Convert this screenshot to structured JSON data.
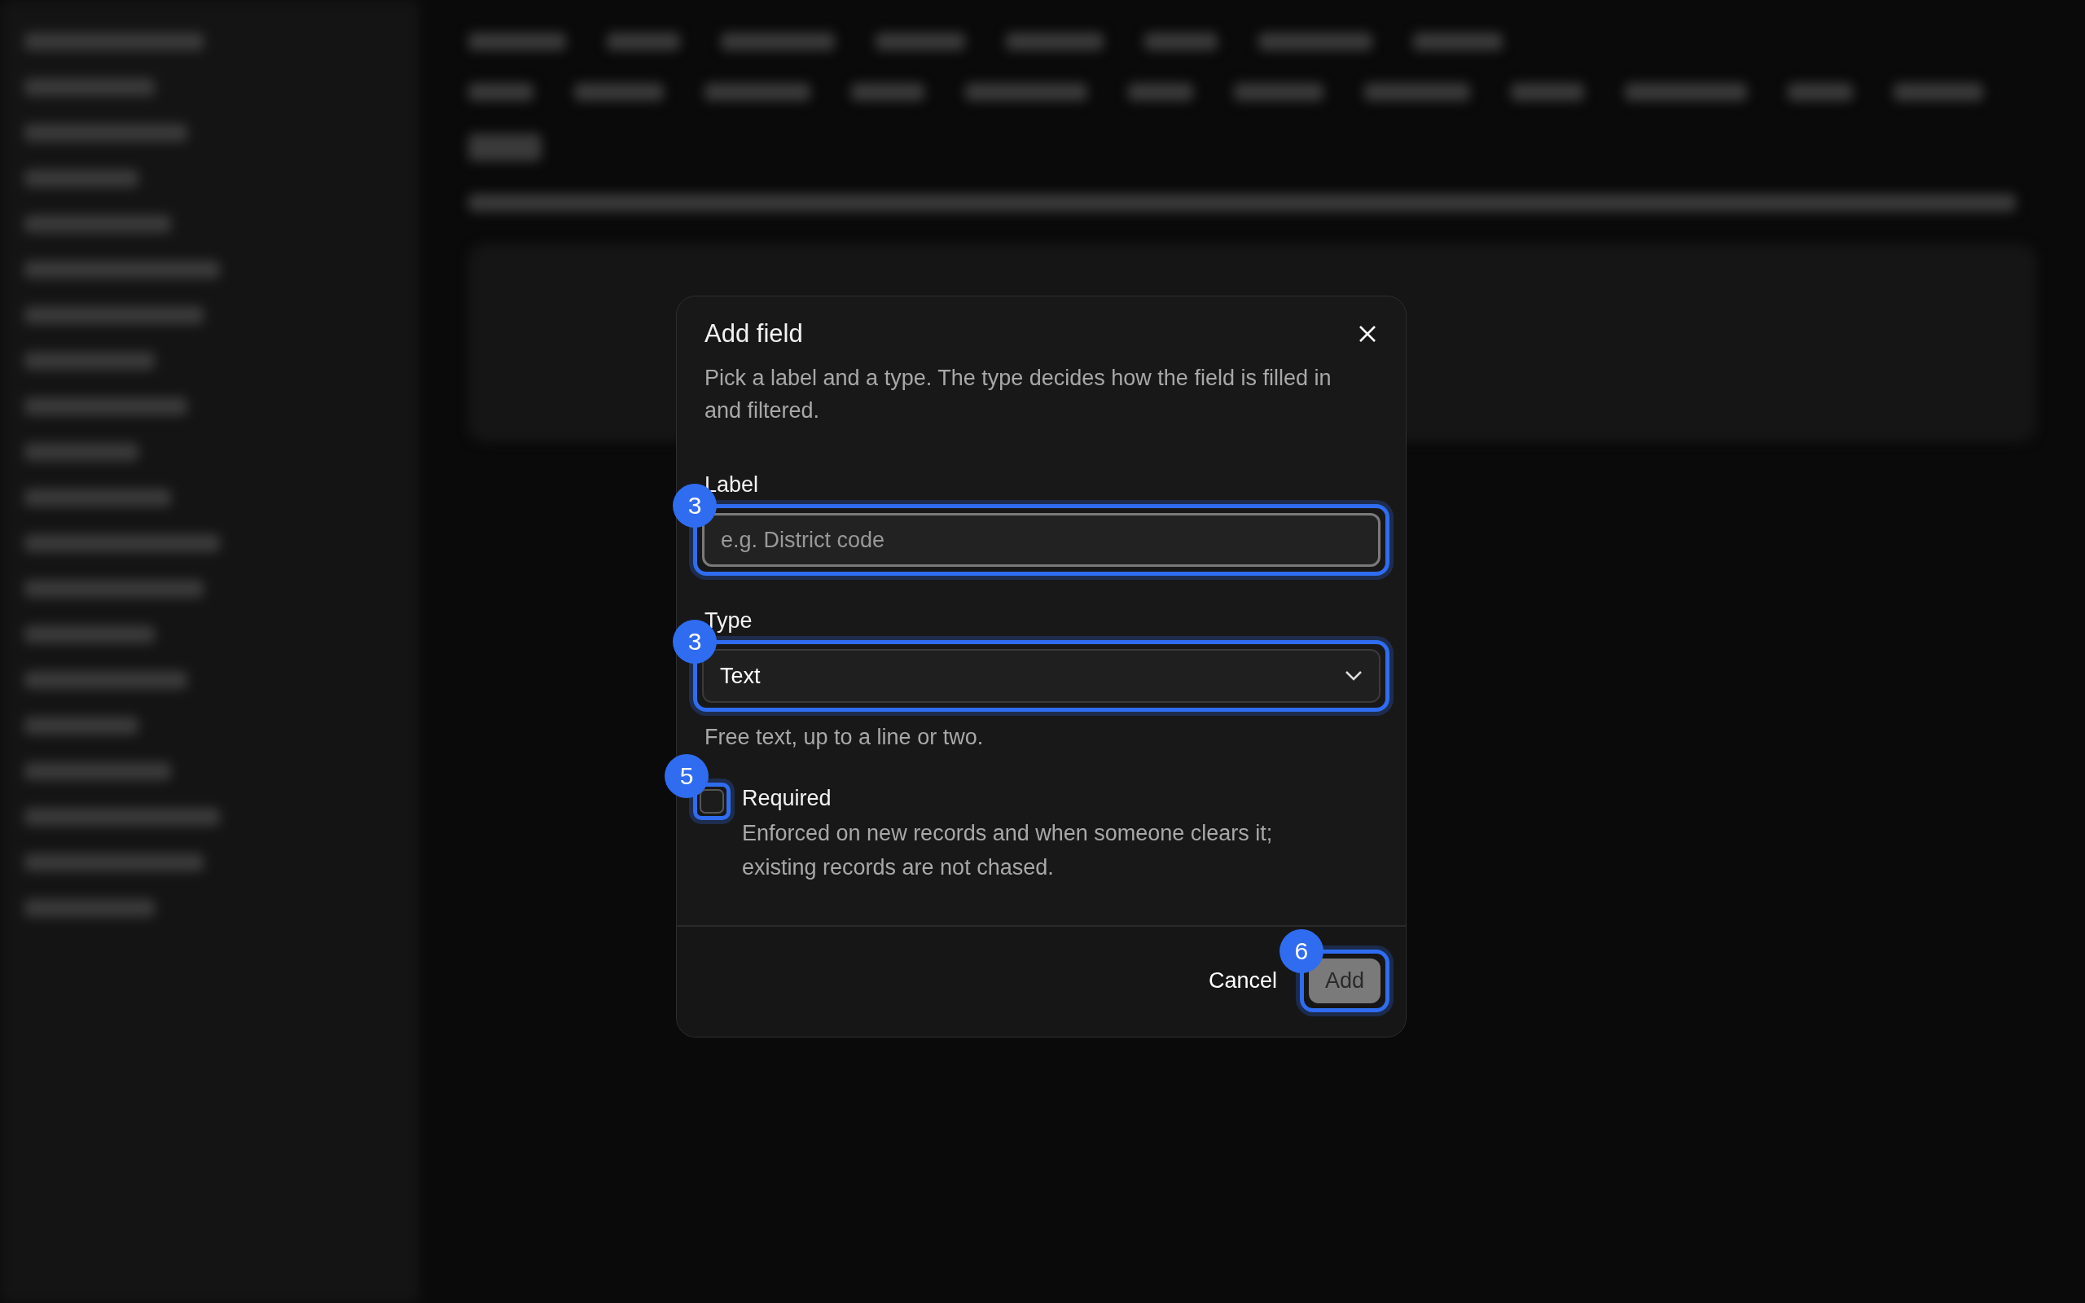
{
  "dialog": {
    "title": "Add field",
    "description": "Pick a label and a type. The type decides how the field is filled in and filtered.",
    "fields": [
      {
        "kind": "text",
        "label": "Label",
        "placeholder": "e.g. District code",
        "focused": true,
        "badge": "3"
      },
      {
        "kind": "select",
        "label": "Type",
        "value": "Text",
        "hint": "Free text, up to a line or two.",
        "focused": true,
        "badge": "3"
      }
    ],
    "checkbox": {
      "label": "Required",
      "description": "Enforced on new records and when someone clears it; existing records are not chased.",
      "checked": false,
      "focused": true,
      "badge": "5"
    },
    "buttons": [
      {
        "kind": "secondary",
        "label": "Cancel",
        "disabled": false,
        "focused": false
      },
      {
        "kind": "primary",
        "label": "Add",
        "disabled": true,
        "focused": true,
        "badge": "6"
      }
    ]
  }
}
